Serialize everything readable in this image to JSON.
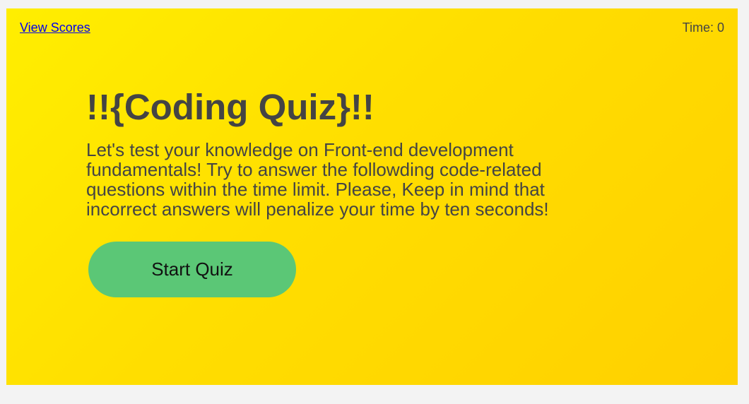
{
  "header": {
    "view_scores_label": "View Scores",
    "timer_label": "Time: 0"
  },
  "main": {
    "title": "!!{Coding Quiz}!!",
    "description": "Let's test your knowledge on Front-end development fundamentals! Try to answer the followding code-related questions within the time limit. Please, Keep in mind that incorrect answers will penalize your time by ten seconds!",
    "start_button_label": "Start Quiz"
  },
  "colors": {
    "background": "#f3f3f3",
    "panel_gradient_start": "#ffee00",
    "panel_gradient_end": "#ffd000",
    "text": "#444444",
    "link": "#0000ee",
    "start_button": "#5bc776"
  }
}
